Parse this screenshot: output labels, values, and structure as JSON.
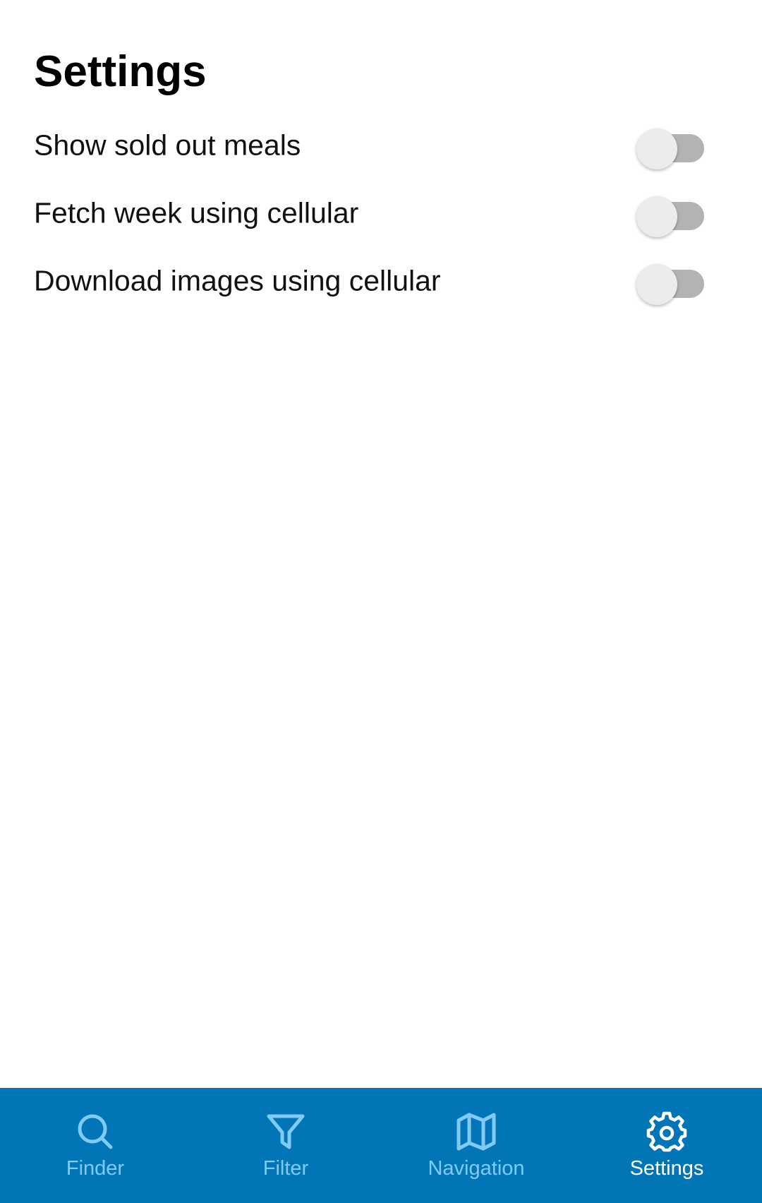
{
  "page": {
    "title": "Settings"
  },
  "settings": [
    {
      "label": "Show sold out meals",
      "enabled": false
    },
    {
      "label": "Fetch week using cellular",
      "enabled": false
    },
    {
      "label": "Download images using cellular",
      "enabled": false
    }
  ],
  "tabbar": {
    "items": [
      {
        "label": "Finder",
        "icon": "search-icon",
        "active": false
      },
      {
        "label": "Filter",
        "icon": "filter-icon",
        "active": false
      },
      {
        "label": "Navigation",
        "icon": "map-icon",
        "active": false
      },
      {
        "label": "Settings",
        "icon": "gear-icon",
        "active": true
      }
    ]
  },
  "colors": {
    "tabbar_background": "#0275b7",
    "tab_inactive": "#7fcbf4",
    "tab_active": "#ffffff",
    "switch_track_off": "#b3b3b3",
    "switch_thumb_off": "#ececec"
  }
}
